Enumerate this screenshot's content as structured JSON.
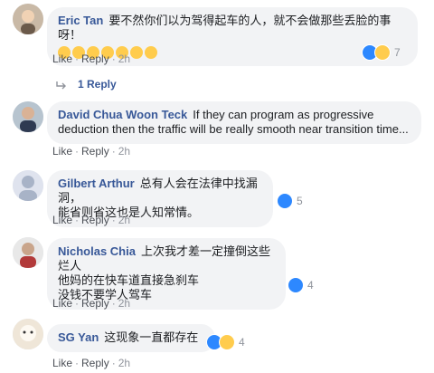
{
  "comments": [
    {
      "author": "Eric Tan",
      "text": "要不然你们以为驾得起车的人，就不会做那些丢脸的事呀！",
      "like": "Like",
      "reply": "Reply",
      "time": "2h",
      "reaction_count": "7",
      "reactions": [
        "like-icon",
        "haha-icon"
      ],
      "emoji_count": "7",
      "replies_link": "1 Reply"
    },
    {
      "author": "David Chua Woon Teck",
      "text_line1": "If they can program as progressive",
      "text_line2": "deduction then the traffic will be really smooth near transition time...",
      "like": "Like",
      "reply": "Reply",
      "time": "2h"
    },
    {
      "author": "Gilbert Arthur",
      "text_line1": "总有人会在法律中找漏洞，",
      "text_line2": "能省则省这也是人知常情。",
      "like": "Like",
      "reply": "Reply",
      "time": "2h",
      "reaction_count": "5",
      "reactions": [
        "like-icon"
      ]
    },
    {
      "author": "Nicholas Chia",
      "text_line1": "上次我才差一定撞倒这些烂人",
      "text_line2": "他妈的在快车道直接急刹车",
      "text_line3": "没钱不要学人驾车",
      "like": "Like",
      "reply": "Reply",
      "time": "2h",
      "reaction_count": "4",
      "reactions": [
        "like-icon"
      ]
    },
    {
      "author": "SG Yan",
      "text": "这现象一直都存在",
      "like": "Like",
      "reply": "Reply",
      "time": "2h",
      "reaction_count": "4",
      "reactions": [
        "like-icon",
        "haha-icon"
      ]
    }
  ],
  "colors": {
    "name": "#385898",
    "bubble": "#f2f3f5",
    "meta": "#90949c",
    "like_blue": "#2d88ff",
    "emoji_yellow": "#ffcc4d"
  }
}
